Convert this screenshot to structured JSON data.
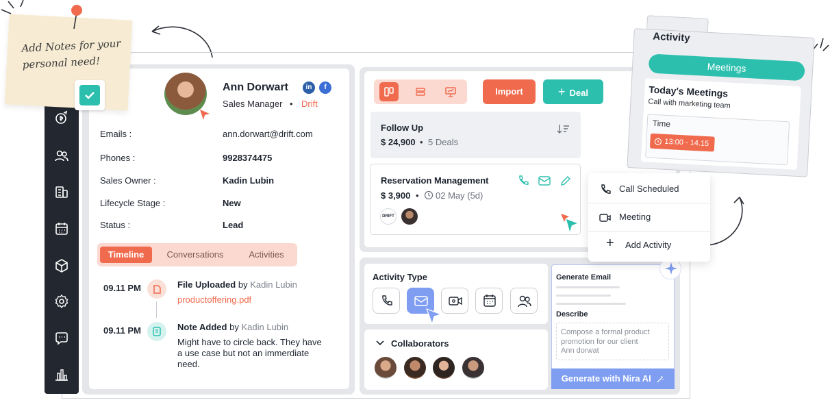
{
  "sticky": {
    "line1": "Add Notes for your",
    "line2": "personal need!"
  },
  "contact": {
    "name": "Ann Dorwart",
    "role": "Sales Manager",
    "separator": "•",
    "company": "Drift",
    "social": {
      "linkedin": "in",
      "facebook": "f"
    },
    "fields": [
      {
        "label": "Emails :",
        "value": "ann.dorwart@drift.com"
      },
      {
        "label": "Phones :",
        "value": "9928374475"
      },
      {
        "label": "Sales Owner :",
        "value": "Kadin Lubin"
      },
      {
        "label": "Lifecycle Stage :",
        "value": "New"
      },
      {
        "label": "Status :",
        "value": "Lead"
      }
    ]
  },
  "tabs": [
    "Timeline",
    "Conversations",
    "Activities"
  ],
  "timeline": [
    {
      "time": "09.11 PM",
      "title": "File Uploaded",
      "by": "by",
      "user": "Kadin Lubin",
      "detail": "productoffering.pdf"
    },
    {
      "time": "09.11 PM",
      "title": "Note Added",
      "by": "by",
      "user": "Kadin Lubin",
      "detail_lines": [
        "Might have to circle back. They have",
        "a use case but not an immerdiate",
        "need."
      ]
    }
  ],
  "pipeline": {
    "import_label": "Import",
    "deal_label": "Deal",
    "deal_plus": "+",
    "stage": {
      "name": "Follow Up",
      "amount": "$ 24,900",
      "sep": "•",
      "deals": "5 Deals"
    },
    "deal": {
      "name": "Reservation Management",
      "amount": "$ 3,900",
      "sep": "•",
      "date": "02 May (5d)",
      "logo_text": "DRIFT"
    }
  },
  "activity_type": {
    "title": "Activity Type"
  },
  "collaborators": {
    "title": "Collaborators"
  },
  "nira": {
    "generate_email": "Generate Email",
    "describe": "Describe",
    "describe_lines": [
      "Compose a formal product",
      "promotion for our client",
      "Ann dorwat"
    ],
    "button": "Generate with Nira AI"
  },
  "folder": {
    "title": "Activity",
    "pill": "Meetings",
    "heading": "Today's Meetings",
    "subtitle": "Call with marketing team",
    "time_label": "Time",
    "time_value": "13:00 - 14.15"
  },
  "menu": {
    "items": [
      "Call Scheduled",
      "Meeting",
      "Add Activity"
    ],
    "add_plus": "+"
  },
  "colors": {
    "accent": "#f06a4d",
    "teal": "#2dbfae",
    "blue": "#7f9ef2",
    "dark": "#23272f"
  }
}
